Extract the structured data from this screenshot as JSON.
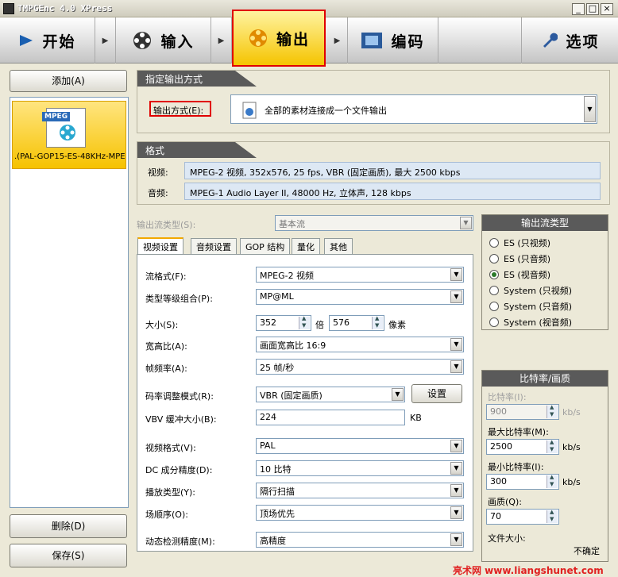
{
  "window": {
    "title": "TMPGEnc 4.0 XPress",
    "min": "_",
    "max": "□",
    "close": "×"
  },
  "toolbar": {
    "start": "开始",
    "input": "输入",
    "output": "输出",
    "encode": "编码",
    "options": "选项"
  },
  "left": {
    "add": "添加(A)",
    "clip": ".(PAL-GOP15-ES-48KHz-MPE(",
    "clip_badge": "MPEG",
    "delete": "删除(D)",
    "save": "保存(S)"
  },
  "output_method": {
    "header": "指定输出方式",
    "label": "输出方式(E):",
    "value": "全部的素材连接成一个文件输出"
  },
  "format": {
    "header": "格式",
    "video_label": "视频:",
    "video": "MPEG-2 视频, 352x576, 25 fps, VBR (固定画质), 最大 2500 kbps",
    "audio_label": "音频:",
    "audio": "MPEG-1 Audio Layer II, 48000 Hz, 立体声, 128 kbps"
  },
  "stream_type": {
    "label": "输出流类型(S):",
    "value": "基本流"
  },
  "tabs": [
    "视频设置",
    "音频设置",
    "GOP 结构",
    "量化",
    "其他"
  ],
  "video": {
    "stream_format_label": "流格式(F):",
    "stream_format": "MPEG-2 视频",
    "profile_label": "类型等级组合(P):",
    "profile": "MP@ML",
    "size_label": "大小(S):",
    "width": "352",
    "times": "倍",
    "height": "576",
    "pixels": "像素",
    "aspect_label": "宽高比(A):",
    "aspect": "画面宽高比 16:9",
    "framerate_label": "帧频率(A):",
    "framerate": "25 帧/秒",
    "rate_mode_label": "码率调整模式(R):",
    "rate_mode": "VBR (固定画质)",
    "settings_btn": "设置",
    "vbv_label": "VBV 缓冲大小(B):",
    "vbv": "224",
    "vbv_unit": "KB",
    "video_format_label": "视频格式(V):",
    "video_format": "PAL",
    "dc_label": "DC 成分精度(D):",
    "dc": "10 比特",
    "scan_label": "播放类型(Y):",
    "scan": "隔行扫描",
    "field_label": "场顺序(O):",
    "field": "顶场优先",
    "motion_label": "动态检测精度(M):",
    "motion": "高精度"
  },
  "output_stream": {
    "header": "输出流类型",
    "options": [
      "ES (只视频)",
      "ES (只音频)",
      "ES (视音频)",
      "System (只视频)",
      "System (只音频)",
      "System (视音频)"
    ],
    "selected_index": 2
  },
  "bitrate": {
    "header": "比特率/画质",
    "rate_label": "比特率(I):",
    "rate": "900",
    "rate_unit": "kb/s",
    "max_label": "最大比特率(M):",
    "max": "2500",
    "max_unit": "kb/s",
    "min_label": "最小比特率(I):",
    "min": "300",
    "min_unit": "kb/s",
    "quality_label": "画质(Q):",
    "quality": "70",
    "filesize_label": "文件大小:",
    "filesize": "不确定"
  },
  "watermark": "亮术网 www.liangshunet.com"
}
